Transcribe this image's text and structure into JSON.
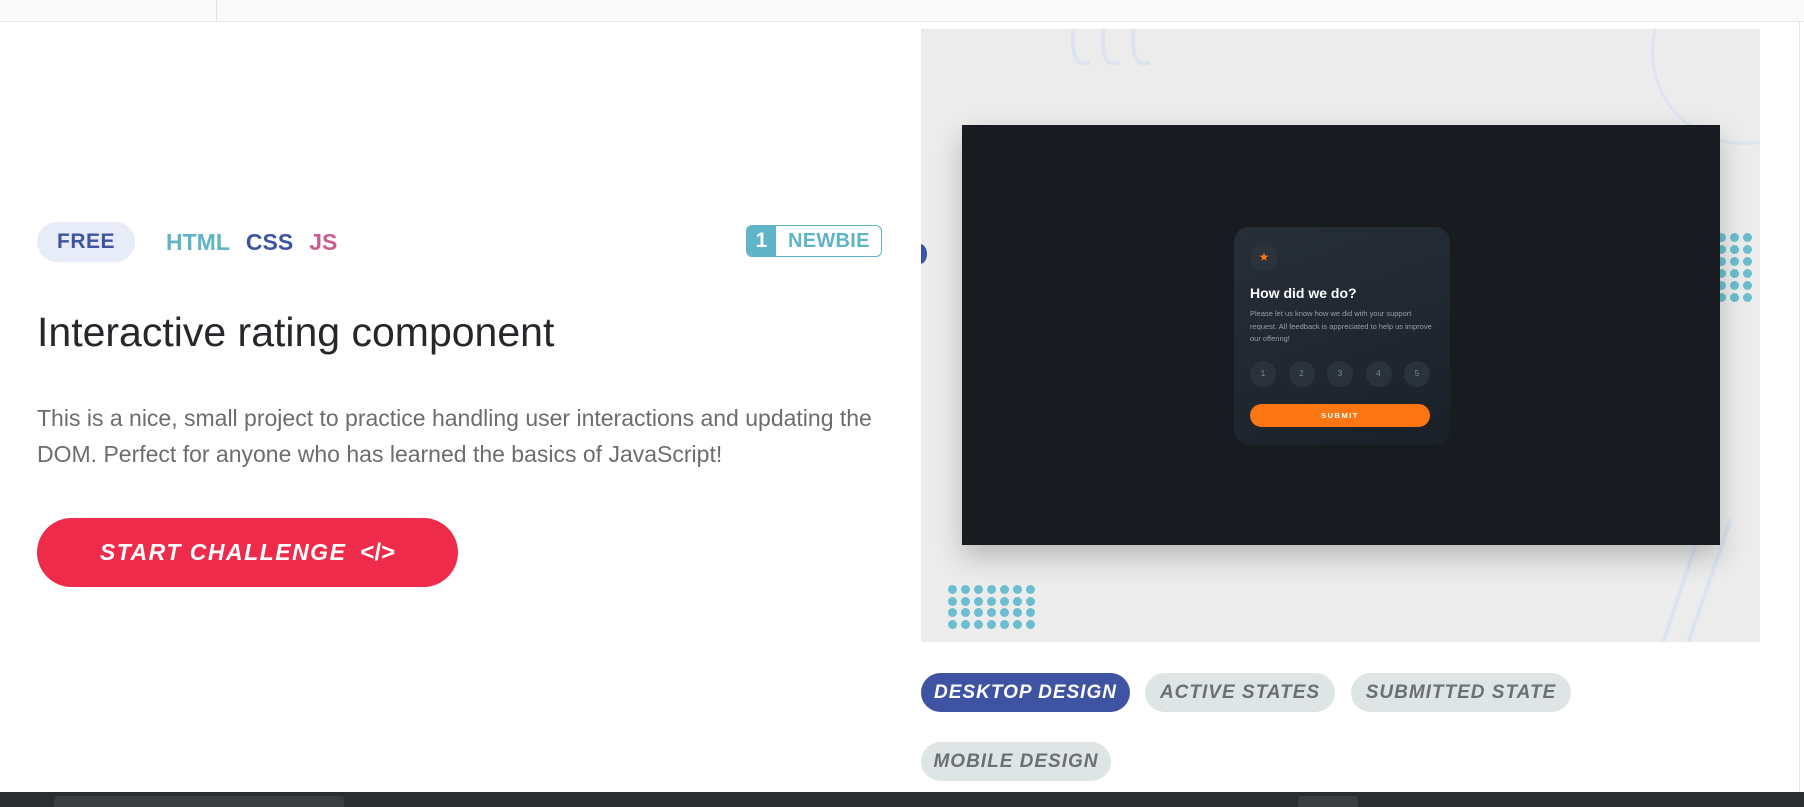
{
  "challenge": {
    "price_badge": "FREE",
    "languages": [
      {
        "label": "HTML",
        "color": "#5fb4c7"
      },
      {
        "label": "CSS",
        "color": "#3e54a3"
      },
      {
        "label": "JS",
        "color": "#c95b8e"
      }
    ],
    "difficulty_number": "1",
    "difficulty_label": "NEWBIE",
    "title": "Interactive rating component",
    "description": "This is a nice, small project to practice handling user interactions and updating the DOM. Perfect for anyone who has learned the basics of JavaScript!",
    "start_button_label": "START CHALLENGE",
    "start_button_icon": "</>"
  },
  "preview": {
    "card": {
      "icon": "star-icon",
      "heading": "How did we do?",
      "text": "Please let us know how we did with your support request. All feedback is appreciated to help us improve our offering!",
      "ratings": [
        "1",
        "2",
        "3",
        "4",
        "5"
      ],
      "submit_label": "SUBMIT"
    }
  },
  "design_tabs": [
    {
      "label": "DESKTOP DESIGN",
      "active": true
    },
    {
      "label": "ACTIVE STATES",
      "active": false
    },
    {
      "label": "SUBMITTED STATE",
      "active": false
    },
    {
      "label": "MOBILE DESIGN",
      "active": false
    }
  ],
  "colors": {
    "accent_red": "#ee2b4a",
    "primary_blue": "#3e54a3",
    "teal": "#5fb4c7",
    "card_orange": "#fc7614"
  }
}
